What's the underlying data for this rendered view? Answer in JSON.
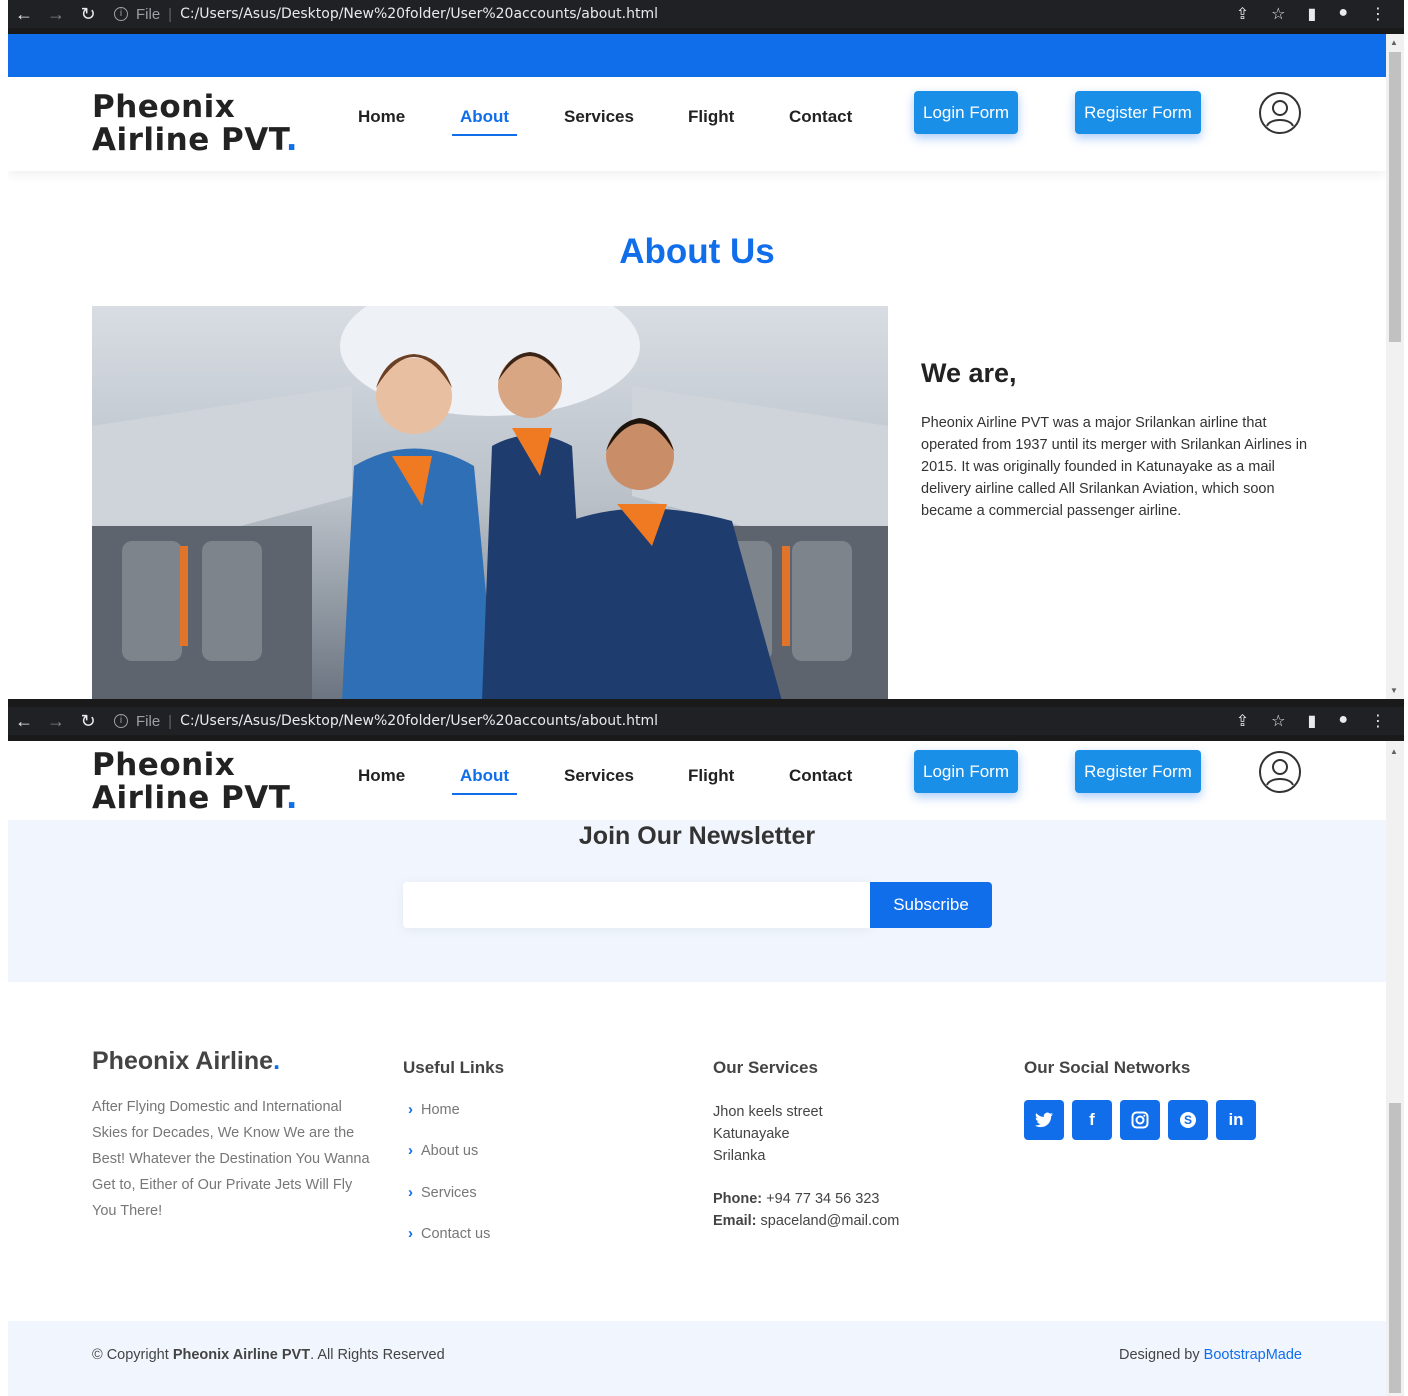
{
  "browser": {
    "file_label": "File",
    "url": "C:/Users/Asus/Desktop/New%20folder/User%20accounts/about.html"
  },
  "header": {
    "logo_line1": "Pheonix",
    "logo_line2": "Airline PVT",
    "logo_dot": ".",
    "nav": {
      "home": "Home",
      "about": "About",
      "services": "Services",
      "flight": "Flight",
      "contact": "Contact"
    },
    "login_button": "Login Form",
    "register_button": "Register Form",
    "user_icon": "user-avatar-icon"
  },
  "about": {
    "title": "About Us",
    "heading": "We are,",
    "text": "Pheonix Airline PVT was a major Srilankan airline that operated from 1937 until its merger with Srilankan Airlines in 2015. It was originally founded in Katunayake as a mail delivery airline called All Srilankan Aviation, which soon became a commercial passenger airline."
  },
  "newsletter": {
    "title": "Join Our Newsletter",
    "input_value": "",
    "subscribe_button": "Subscribe"
  },
  "footer": {
    "brand": "Pheonix Airline",
    "brand_dot": ".",
    "description": "After Flying Domestic and International Skies for Decades, We Know We are the Best! Whatever the Destination You Wanna Get to, Either of Our Private Jets Will Fly You There!",
    "useful_links_title": "Useful Links",
    "useful_links": [
      "Home",
      "About us",
      "Services",
      "Contact us"
    ],
    "services_title": "Our Services",
    "address_line1": "Jhon keels street",
    "address_line2": "Katunayake",
    "address_line3": "Srilanka",
    "phone_label": "Phone:",
    "phone": "+94 77 34 56 323",
    "email_label": "Email:",
    "email": "spaceland@mail.com",
    "social_title": "Our Social Networks",
    "social_icons": [
      "twitter-icon",
      "facebook-icon",
      "instagram-icon",
      "skype-icon",
      "linkedin-icon"
    ]
  },
  "copyright": {
    "prefix": "© Copyright ",
    "brand": "Pheonix Airline PVT",
    "suffix": ". All Rights Reserved",
    "designed_by": "Designed by ",
    "designer": "BootstrapMade"
  },
  "colors": {
    "accent": "#106eea",
    "button_blue": "#1a8fe8",
    "newsletter_bg": "#f1f6fe"
  }
}
